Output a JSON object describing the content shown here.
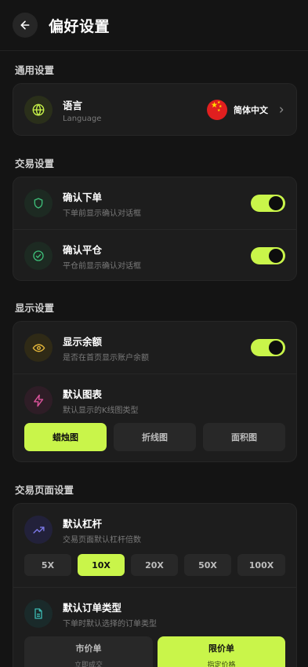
{
  "header": {
    "title": "偏好设置",
    "back_icon": "arrow-left-icon"
  },
  "colors": {
    "accent": "#c9f54a",
    "background": "#141414",
    "card": "#1d1d1d"
  },
  "general": {
    "section_title": "通用设置",
    "language": {
      "title": "语言",
      "subtitle": "Language",
      "value": "简体中文",
      "icon": "globe-icon",
      "flag": "china-flag-icon"
    }
  },
  "trading": {
    "section_title": "交易设置",
    "confirm_order": {
      "title": "确认下单",
      "subtitle": "下单前显示确认对话框",
      "icon": "shield-icon",
      "enabled": true
    },
    "confirm_close": {
      "title": "确认平仓",
      "subtitle": "平仓前显示确认对话框",
      "icon": "check-circle-icon",
      "enabled": true
    }
  },
  "display": {
    "section_title": "显示设置",
    "show_balance": {
      "title": "显示余额",
      "subtitle": "是否在首页显示账户余额",
      "icon": "eye-icon",
      "enabled": true
    },
    "default_chart": {
      "title": "默认图表",
      "subtitle": "默认显示的K线图类型",
      "icon": "activity-icon",
      "options": [
        "蜡烛图",
        "折线图",
        "面积图"
      ],
      "selected": "蜡烛图"
    }
  },
  "trade_page": {
    "section_title": "交易页面设置",
    "default_leverage": {
      "title": "默认杠杆",
      "subtitle": "交易页面默认杠杆倍数",
      "icon": "trending-up-icon",
      "options": [
        "5X",
        "10X",
        "20X",
        "50X",
        "100X"
      ],
      "selected": "10X"
    },
    "default_order_type": {
      "title": "默认订单类型",
      "subtitle": "下单时默认选择的订单类型",
      "icon": "file-text-icon",
      "options": [
        {
          "label": "市价单",
          "desc": "立即成交"
        },
        {
          "label": "限价单",
          "desc": "指定价格"
        }
      ],
      "selected": "限价单"
    }
  }
}
